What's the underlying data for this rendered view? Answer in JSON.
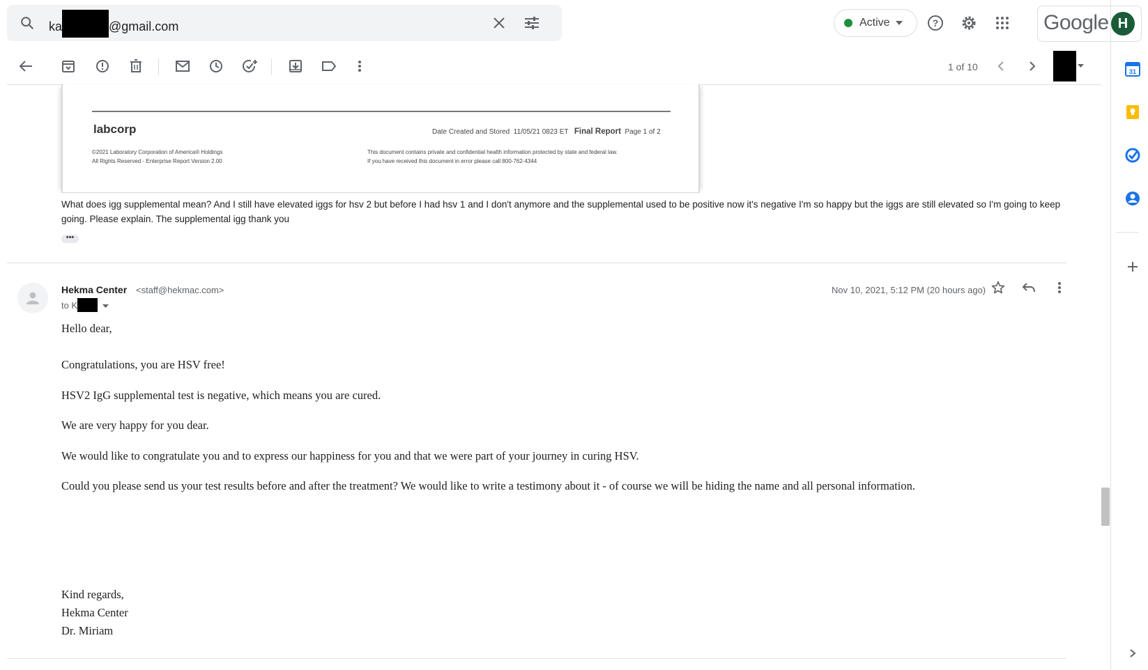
{
  "search": {
    "prefix": "ka",
    "suffix": "@gmail.com"
  },
  "status": {
    "label": "Active",
    "color": "#1e8e3e"
  },
  "brand": {
    "wordmark": "Google",
    "avatar_initial": "H"
  },
  "toolbar": {
    "icons": [
      "back-icon",
      "archive-icon",
      "report-spam-icon",
      "delete-icon",
      "mark-unread-icon",
      "snooze-icon",
      "add-task-icon",
      "move-to-icon",
      "label-icon",
      "more-icon"
    ],
    "pager": "1 of 10"
  },
  "attachment": {
    "logo": "labcorp",
    "date_label": "Date Created and Stored",
    "date_value": "11/05/21 0823 ET",
    "report_title": "Final Report",
    "page": "Page 1 of 2",
    "copyright_1": "©2021 Laboratory Corporation of America® Holdings",
    "copyright_2": "All Rights Reserved - Enterprise Report Version 2.00",
    "notice_1": "This document contains private and confidential health information protected by state and federal law.",
    "notice_2": "If you have received this document in error please call 800-762-4344"
  },
  "previous_message": {
    "text": "What does igg supplemental mean? And I still have elevated iggs for hsv 2 but before I had hsv 1 and I don't anymore and the supplemental used to be positive now it's negative I'm so happy but the iggs are still elevated so I'm going to keep going. Please explain. The supplemental igg thank you",
    "ellipsis": "•••"
  },
  "message": {
    "sender_name": "Hekma Center",
    "sender_email": "<staff@hekmac.com>",
    "to_prefix": "to K",
    "datetime": "Nov 10, 2021, 5:12 PM (20 hours ago)",
    "greeting": "Hello dear,",
    "paragraphs": [
      "Congratulations, you are HSV free!",
      "HSV2 IgG supplemental test is negative, which means you are cured.",
      "We are very happy for you dear.",
      "We would like to congratulate you and to express our happiness for you and that we were part of your journey in curing HSV.",
      "Could you please send us your test results before and after the treatment? We would like to write a testimony about it - of course we will be hiding the name and all personal information."
    ],
    "signature": [
      "Kind regards,",
      "Hekma Center",
      "Dr. Miriam"
    ]
  },
  "side_panel": {
    "icons": [
      "calendar-icon",
      "keep-icon",
      "tasks-icon",
      "contacts-icon",
      "add-icon",
      "expand-icon"
    ],
    "colors": {
      "calendar": "#1a73e8",
      "keep": "#fbbc04",
      "tasks": "#1a73e8",
      "contacts": "#1a73e8"
    }
  }
}
